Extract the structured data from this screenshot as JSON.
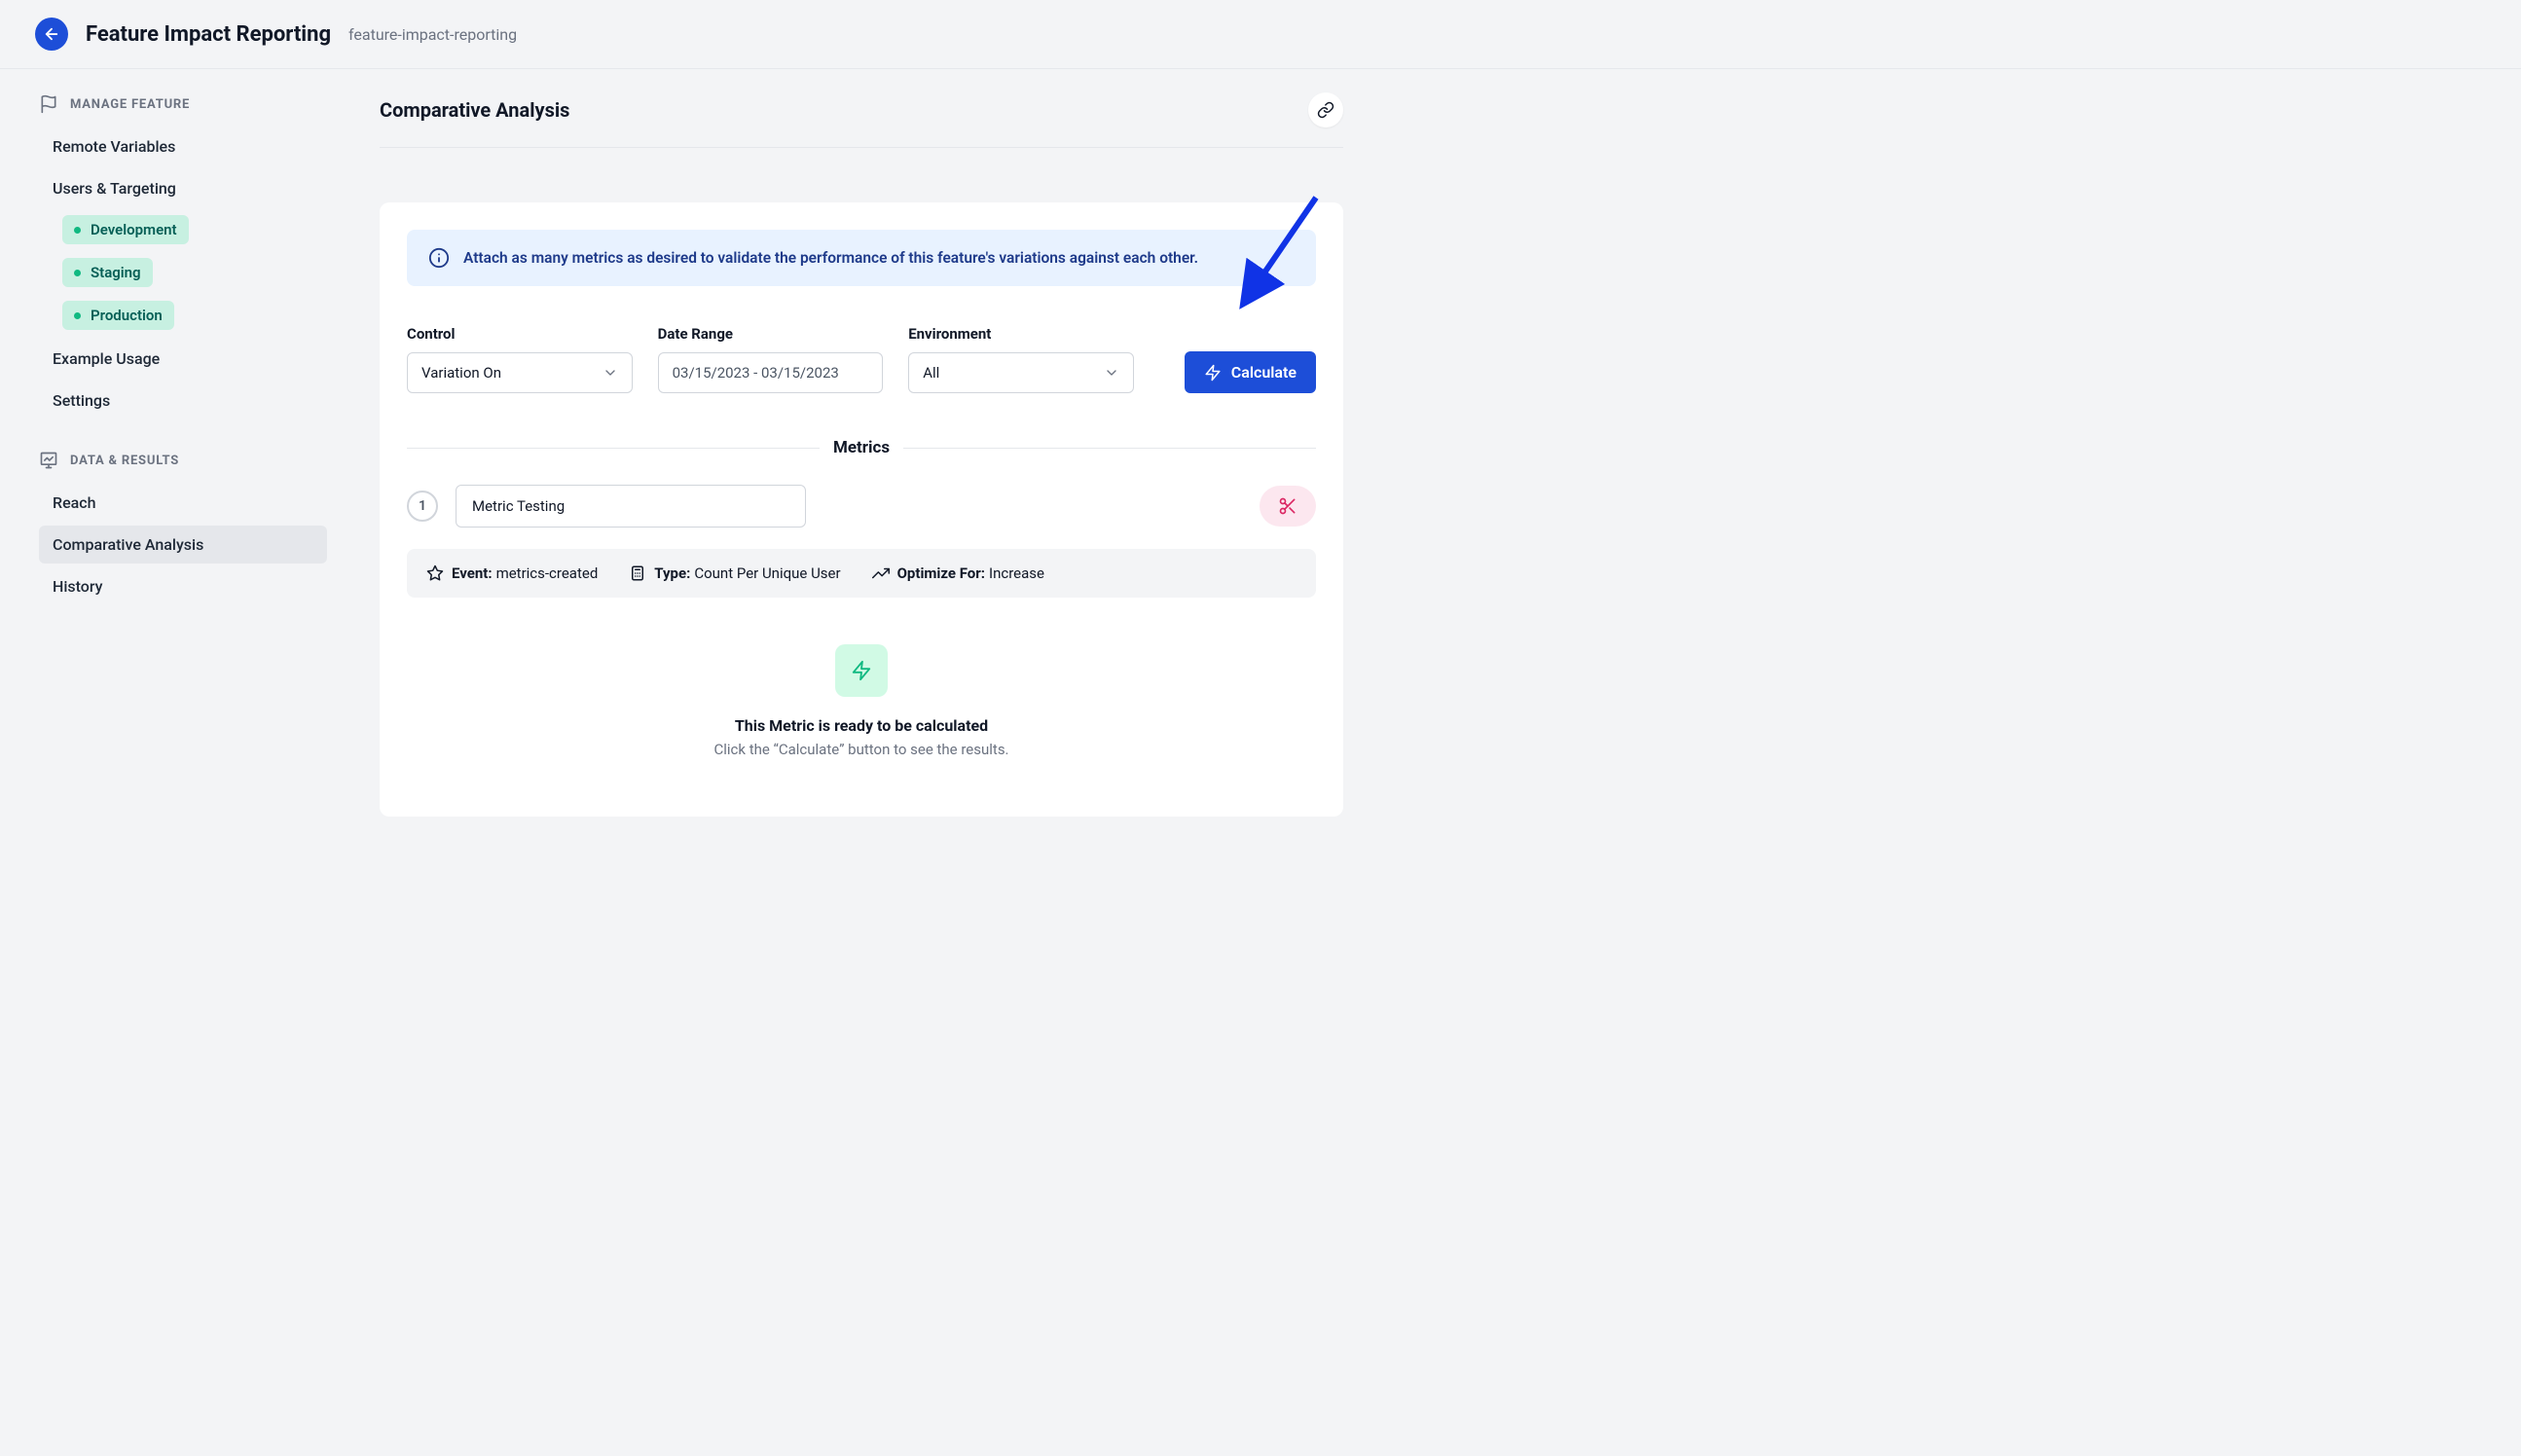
{
  "header": {
    "title": "Feature Impact Reporting",
    "slug": "feature-impact-reporting"
  },
  "sidebar": {
    "manage_header": "Manage Feature",
    "items_manage": [
      "Remote Variables",
      "Users & Targeting",
      "Example Usage",
      "Settings"
    ],
    "environments": [
      "Development",
      "Staging",
      "Production"
    ],
    "data_header": "Data & Results",
    "items_data": [
      "Reach",
      "Comparative Analysis",
      "History"
    ],
    "active": "Comparative Analysis"
  },
  "main": {
    "page_title": "Comparative Analysis",
    "banner": "Attach as many metrics as desired to validate the performance of this feature's variations against each other.",
    "control_label": "Control",
    "control_value": "Variation On",
    "date_label": "Date Range",
    "date_value": "03/15/2023 - 03/15/2023",
    "env_label": "Environment",
    "env_value": "All",
    "calculate_label": "Calculate",
    "metrics_divider": "Metrics",
    "metric": {
      "number": "1",
      "name": "Metric Testing",
      "event_label": "Event:",
      "event_value": "metrics-created",
      "type_label": "Type:",
      "type_value": "Count Per Unique User",
      "opt_label": "Optimize For:",
      "opt_value": "Increase"
    },
    "empty": {
      "title": "This Metric is ready to be calculated",
      "subtitle": "Click the “Calculate” button to see the results."
    }
  }
}
